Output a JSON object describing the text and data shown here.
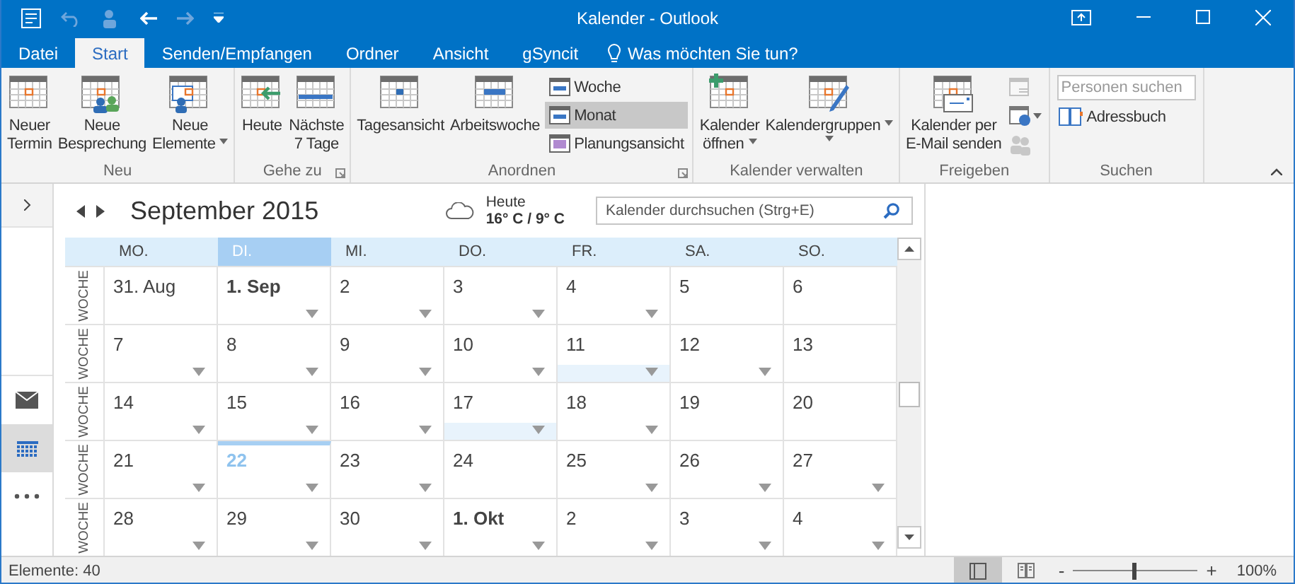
{
  "window": {
    "title": "Kalender - Outlook"
  },
  "menu_tabs": [
    {
      "label": "Datei",
      "selected": false
    },
    {
      "label": "Start",
      "selected": true
    },
    {
      "label": "Senden/Empfangen",
      "selected": false
    },
    {
      "label": "Ordner",
      "selected": false
    },
    {
      "label": "Ansicht",
      "selected": false
    },
    {
      "label": "gSyncit",
      "selected": false
    }
  ],
  "tell_me": "Was möchten Sie tun?",
  "ribbon": {
    "groups": [
      {
        "label": "Neu",
        "launcher": false,
        "items": [
          {
            "kind": "large",
            "lines": [
              "Neuer",
              "Termin"
            ],
            "dropdown": false
          },
          {
            "kind": "large",
            "lines": [
              "Neue",
              "Besprechung"
            ],
            "dropdown": false
          },
          {
            "kind": "large",
            "lines": [
              "Neue",
              "Elemente"
            ],
            "dropdown": true
          }
        ]
      },
      {
        "label": "Gehe zu",
        "launcher": true,
        "items": [
          {
            "kind": "large",
            "lines": [
              "Heute"
            ],
            "dropdown": false
          },
          {
            "kind": "large",
            "lines": [
              "Nächste",
              "7 Tage"
            ],
            "dropdown": false
          }
        ]
      },
      {
        "label": "Anordnen",
        "launcher": true,
        "items": [
          {
            "kind": "large",
            "lines": [
              "Tagesansicht"
            ],
            "dropdown": false
          },
          {
            "kind": "large",
            "lines": [
              "Arbeitswoche"
            ],
            "dropdown": false
          },
          {
            "kind": "stack",
            "entries": [
              {
                "label": "Woche",
                "selected": false
              },
              {
                "label": "Monat",
                "selected": true
              },
              {
                "label": "Planungsansicht",
                "selected": false
              }
            ]
          }
        ]
      },
      {
        "label": "Kalender verwalten",
        "launcher": false,
        "items": [
          {
            "kind": "large",
            "lines": [
              "Kalender",
              "öffnen"
            ],
            "dropdown": true
          },
          {
            "kind": "large",
            "lines": [
              "Kalendergruppen"
            ],
            "dropdown": true
          }
        ]
      },
      {
        "label": "Freigeben",
        "launcher": false,
        "items": [
          {
            "kind": "large",
            "lines": [
              "Kalender per",
              "E-Mail senden"
            ],
            "dropdown": false
          },
          {
            "kind": "icons",
            "entries": [
              {
                "disabled": true,
                "dropdown": false
              },
              {
                "disabled": false,
                "dropdown": true
              },
              {
                "disabled": true,
                "dropdown": false
              }
            ]
          }
        ]
      },
      {
        "label": "Suchen",
        "launcher": false,
        "items": [
          {
            "kind": "search",
            "placeholder": "Personen suchen"
          },
          {
            "kind": "small",
            "label": "Adressbuch"
          }
        ]
      }
    ]
  },
  "nav": [
    {
      "kind": "mail",
      "selected": false
    },
    {
      "kind": "calendar",
      "selected": true
    },
    {
      "kind": "more",
      "selected": false
    }
  ],
  "calendar": {
    "title": "September 2015",
    "weather": {
      "label": "Heute",
      "temps": "16° C / 9° C"
    },
    "search": {
      "placeholder": "Kalender durchsuchen (Strg+E)"
    },
    "days": [
      {
        "label": "MO.",
        "selected": false
      },
      {
        "label": "DI.",
        "selected": true
      },
      {
        "label": "MI.",
        "selected": false
      },
      {
        "label": "DO.",
        "selected": false
      },
      {
        "label": "FR.",
        "selected": false
      },
      {
        "label": "SA.",
        "selected": false
      },
      {
        "label": "SO.",
        "selected": false
      }
    ],
    "weeks": [
      {
        "label": "WOCHE",
        "cells": [
          {
            "day": "31. Aug",
            "bold": false,
            "today": false,
            "band": false,
            "more": false
          },
          {
            "day": "1. Sep",
            "bold": true,
            "today": false,
            "band": false,
            "more": true
          },
          {
            "day": "2",
            "bold": false,
            "today": false,
            "band": false,
            "more": true
          },
          {
            "day": "3",
            "bold": false,
            "today": false,
            "band": false,
            "more": true
          },
          {
            "day": "4",
            "bold": false,
            "today": false,
            "band": false,
            "more": true
          },
          {
            "day": "5",
            "bold": false,
            "today": false,
            "band": false,
            "more": false
          },
          {
            "day": "6",
            "bold": false,
            "today": false,
            "band": false,
            "more": false
          }
        ]
      },
      {
        "label": "WOCHE",
        "cells": [
          {
            "day": "7",
            "bold": false,
            "today": false,
            "band": false,
            "more": true
          },
          {
            "day": "8",
            "bold": false,
            "today": false,
            "band": false,
            "more": true
          },
          {
            "day": "9",
            "bold": false,
            "today": false,
            "band": false,
            "more": true
          },
          {
            "day": "10",
            "bold": false,
            "today": false,
            "band": false,
            "more": true
          },
          {
            "day": "11",
            "bold": false,
            "today": false,
            "band": true,
            "more": true
          },
          {
            "day": "12",
            "bold": false,
            "today": false,
            "band": false,
            "more": true
          },
          {
            "day": "13",
            "bold": false,
            "today": false,
            "band": false,
            "more": false
          }
        ]
      },
      {
        "label": "WOCHE",
        "cells": [
          {
            "day": "14",
            "bold": false,
            "today": false,
            "band": false,
            "more": true
          },
          {
            "day": "15",
            "bold": false,
            "today": false,
            "band": false,
            "more": true
          },
          {
            "day": "16",
            "bold": false,
            "today": false,
            "band": false,
            "more": true
          },
          {
            "day": "17",
            "bold": false,
            "today": false,
            "band": true,
            "more": true
          },
          {
            "day": "18",
            "bold": false,
            "today": false,
            "band": false,
            "more": true
          },
          {
            "day": "19",
            "bold": false,
            "today": false,
            "band": false,
            "more": false
          },
          {
            "day": "20",
            "bold": false,
            "today": false,
            "band": false,
            "more": false
          }
        ]
      },
      {
        "label": "WOCHE",
        "cells": [
          {
            "day": "21",
            "bold": false,
            "today": false,
            "band": false,
            "more": true
          },
          {
            "day": "22",
            "bold": false,
            "today": true,
            "band": false,
            "more": true
          },
          {
            "day": "23",
            "bold": false,
            "today": false,
            "band": false,
            "more": true
          },
          {
            "day": "24",
            "bold": false,
            "today": false,
            "band": false,
            "more": false
          },
          {
            "day": "25",
            "bold": false,
            "today": false,
            "band": false,
            "more": true
          },
          {
            "day": "26",
            "bold": false,
            "today": false,
            "band": false,
            "more": true
          },
          {
            "day": "27",
            "bold": false,
            "today": false,
            "band": false,
            "more": true
          }
        ]
      },
      {
        "label": "WOCHE",
        "cells": [
          {
            "day": "28",
            "bold": false,
            "today": false,
            "band": false,
            "more": true
          },
          {
            "day": "29",
            "bold": false,
            "today": false,
            "band": false,
            "more": true
          },
          {
            "day": "30",
            "bold": false,
            "today": false,
            "band": false,
            "more": true
          },
          {
            "day": "1. Okt",
            "bold": true,
            "today": false,
            "band": false,
            "more": true
          },
          {
            "day": "2",
            "bold": false,
            "today": false,
            "band": false,
            "more": true
          },
          {
            "day": "3",
            "bold": false,
            "today": false,
            "band": false,
            "more": true
          },
          {
            "day": "4",
            "bold": false,
            "today": false,
            "band": false,
            "more": true
          }
        ]
      }
    ]
  },
  "status_bar": {
    "items": "Elemente: 40",
    "zoom_out": "-",
    "zoom_in": "+",
    "zoom": {
      "level": 0.48
    },
    "zoom_reading": "100%"
  }
}
